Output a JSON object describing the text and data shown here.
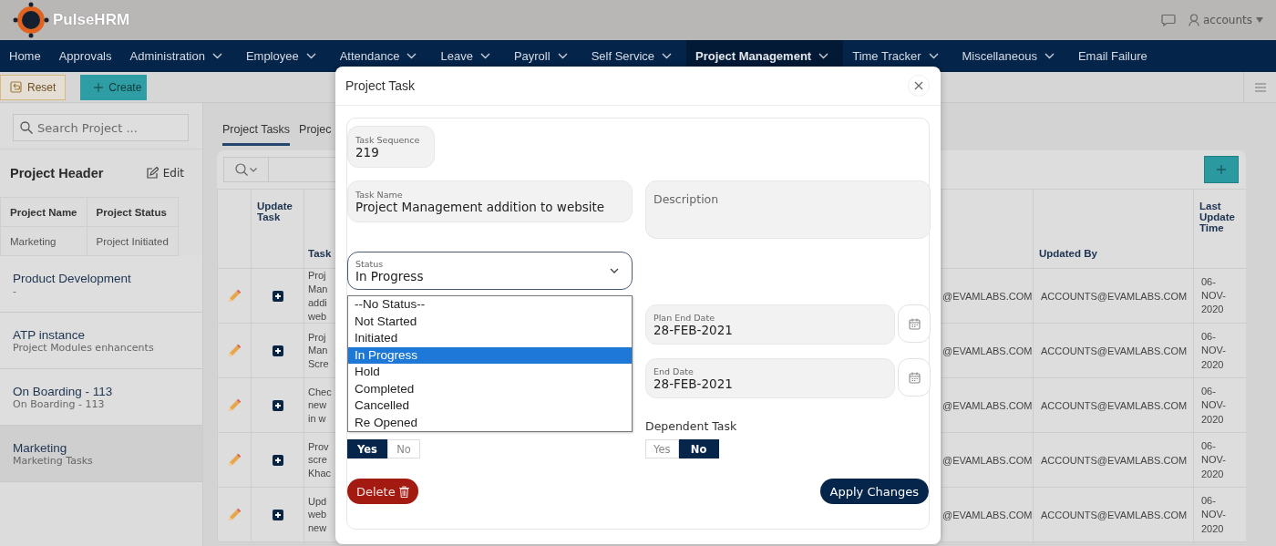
{
  "app": {
    "brand": "PulseHRM",
    "user": "accounts"
  },
  "nav": [
    {
      "label": "Home",
      "dropdown": false,
      "selected": false
    },
    {
      "label": "Approvals",
      "dropdown": false,
      "selected": false
    },
    {
      "label": "Administration",
      "dropdown": true,
      "selected": false
    },
    {
      "label": "Employee",
      "dropdown": true,
      "selected": false
    },
    {
      "label": "Attendance",
      "dropdown": true,
      "selected": false
    },
    {
      "label": "Leave",
      "dropdown": true,
      "selected": false
    },
    {
      "label": "Payroll",
      "dropdown": true,
      "selected": false
    },
    {
      "label": "Self Service",
      "dropdown": true,
      "selected": false
    },
    {
      "label": "Project Management",
      "dropdown": true,
      "selected": true
    },
    {
      "label": "Time Tracker",
      "dropdown": true,
      "selected": false
    },
    {
      "label": "Miscellaneous",
      "dropdown": true,
      "selected": false
    },
    {
      "label": "Email Failure",
      "dropdown": false,
      "selected": false
    }
  ],
  "toolbar": [
    {
      "label": "Reset",
      "kind": "reset"
    },
    {
      "label": "Create",
      "kind": "create"
    }
  ],
  "sidebar": {
    "search_placeholder": "Search Project ...",
    "header_title": "Project Header",
    "edit_label": "Edit",
    "header_table": {
      "columns": [
        "Project Name",
        "Project Status"
      ],
      "rows": [
        [
          "Marketing",
          "Project Initiated"
        ]
      ]
    },
    "projects": [
      {
        "name": "Product Development",
        "subtitle": "-",
        "selected": false
      },
      {
        "name": "ATP instance",
        "subtitle": "Project Modules enhancents",
        "selected": false
      },
      {
        "name": "On Boarding - 113",
        "subtitle": "On Boarding - 113",
        "selected": false
      },
      {
        "name": "Marketing",
        "subtitle": "Marketing Tasks",
        "selected": true
      }
    ]
  },
  "main": {
    "tabs": [
      {
        "label": "Project Tasks",
        "selected": true
      },
      {
        "label": "Projec",
        "selected": false
      }
    ],
    "table": {
      "columns": {
        "update_task": "Update Task",
        "task": "Task",
        "updated_by": "Updated By",
        "last_update_time": "Last Update Time"
      },
      "rows": [
        {
          "task": "Proj\nMan\naddi\nweb",
          "column_4": "@EVAMLABS.COM",
          "updated_by": "ACCOUNTS@EVAMLABS.COM",
          "last_update_time": "06-NOV-2020"
        },
        {
          "task": "Proj\nMan\nScre",
          "column_4": "@EVAMLABS.COM",
          "updated_by": "ACCOUNTS@EVAMLABS.COM",
          "last_update_time": "06-NOV-2020"
        },
        {
          "task": "Chec\nnew\nin w",
          "column_4": "@EVAMLABS.COM",
          "updated_by": "ACCOUNTS@EVAMLABS.COM",
          "last_update_time": "06-NOV-2020"
        },
        {
          "task": "Prov\nscre\nKhac",
          "column_4": "@EVAMLABS.COM",
          "updated_by": "ACCOUNTS@EVAMLABS.COM",
          "last_update_time": "06-NOV-2020"
        },
        {
          "task": "Upd\nweb\nnew",
          "column_4": "@EVAMLABS.COM",
          "updated_by": "ACCOUNTS@EVAMLABS.COM",
          "last_update_time": "06-NOV-2020"
        }
      ]
    }
  },
  "modal": {
    "title": "Project Task",
    "task_sequence": {
      "label": "Task Sequence",
      "value": "219"
    },
    "task_name": {
      "label": "Task Name",
      "value": "Project Management addition to website"
    },
    "description": {
      "placeholder": "Description"
    },
    "status": {
      "label": "Status",
      "value": "In Progress",
      "expanded": true,
      "options": [
        {
          "label": "--No Status--",
          "selected": false
        },
        {
          "label": "Not Started",
          "selected": false
        },
        {
          "label": "Initiated",
          "selected": false
        },
        {
          "label": "In Progress",
          "selected": true
        },
        {
          "label": "Hold",
          "selected": false
        },
        {
          "label": "Completed",
          "selected": false
        },
        {
          "label": "Cancelled",
          "selected": false
        },
        {
          "label": "Re Opened",
          "selected": false
        }
      ]
    },
    "plan_end_date": {
      "label": "Plan End Date",
      "value": "28-FEB-2021"
    },
    "end_date": {
      "label": "End Date",
      "value": "28-FEB-2021"
    },
    "toggle": {
      "options": [
        {
          "label": "Yes",
          "selected": true
        },
        {
          "label": "No",
          "selected": false
        }
      ]
    },
    "dependent_task": {
      "label": "Dependent Task",
      "options": [
        {
          "label": "Yes",
          "selected": false
        },
        {
          "label": "No",
          "selected": true
        }
      ]
    },
    "buttons": [
      {
        "label": "Delete",
        "kind": "delete"
      },
      {
        "label": "Apply Changes",
        "kind": "apply"
      }
    ]
  }
}
